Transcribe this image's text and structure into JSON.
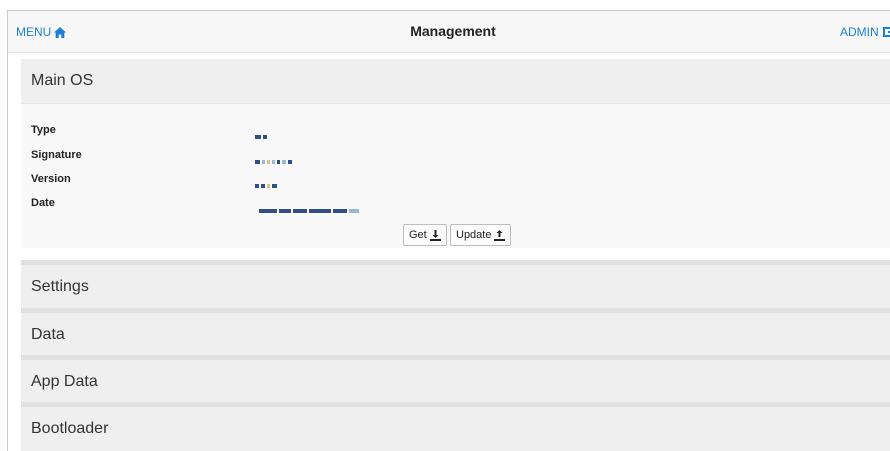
{
  "topbar": {
    "menu_label": "MENU",
    "title": "Management",
    "admin_label": "ADMIN"
  },
  "main_os": {
    "title": "Main OS",
    "fields": [
      {
        "label": "Type"
      },
      {
        "label": "Signature"
      },
      {
        "label": "Version"
      },
      {
        "label": "Date"
      }
    ],
    "get_label": "Get",
    "update_label": "Update"
  },
  "sections": [
    {
      "title": "Settings"
    },
    {
      "title": "Data"
    },
    {
      "title": "App Data"
    },
    {
      "title": "Bootloader"
    }
  ],
  "icons": {
    "menu": "home-icon",
    "admin": "logout-icon",
    "get": "download-icon",
    "update": "upload-icon"
  },
  "colors": {
    "link": "#1d7fd6",
    "panel": "#efefef"
  }
}
